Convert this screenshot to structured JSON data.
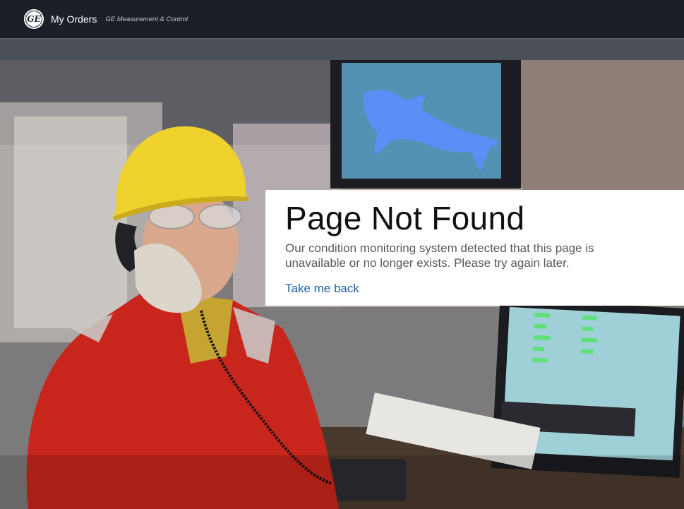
{
  "header": {
    "logo_text": "GE",
    "title": "My Orders",
    "subtitle": "GE Measurement & Control"
  },
  "error_card": {
    "heading": "Page Not Found",
    "message": "Our condition monitoring system detected that this page is unavailable or no longer exists. Please try again later.",
    "link_label": "Take me back"
  },
  "colors": {
    "topbar": "#1a1f28",
    "subbar": "#4b5058",
    "link": "#1d5fa8",
    "whale": "#5b8ff5"
  }
}
